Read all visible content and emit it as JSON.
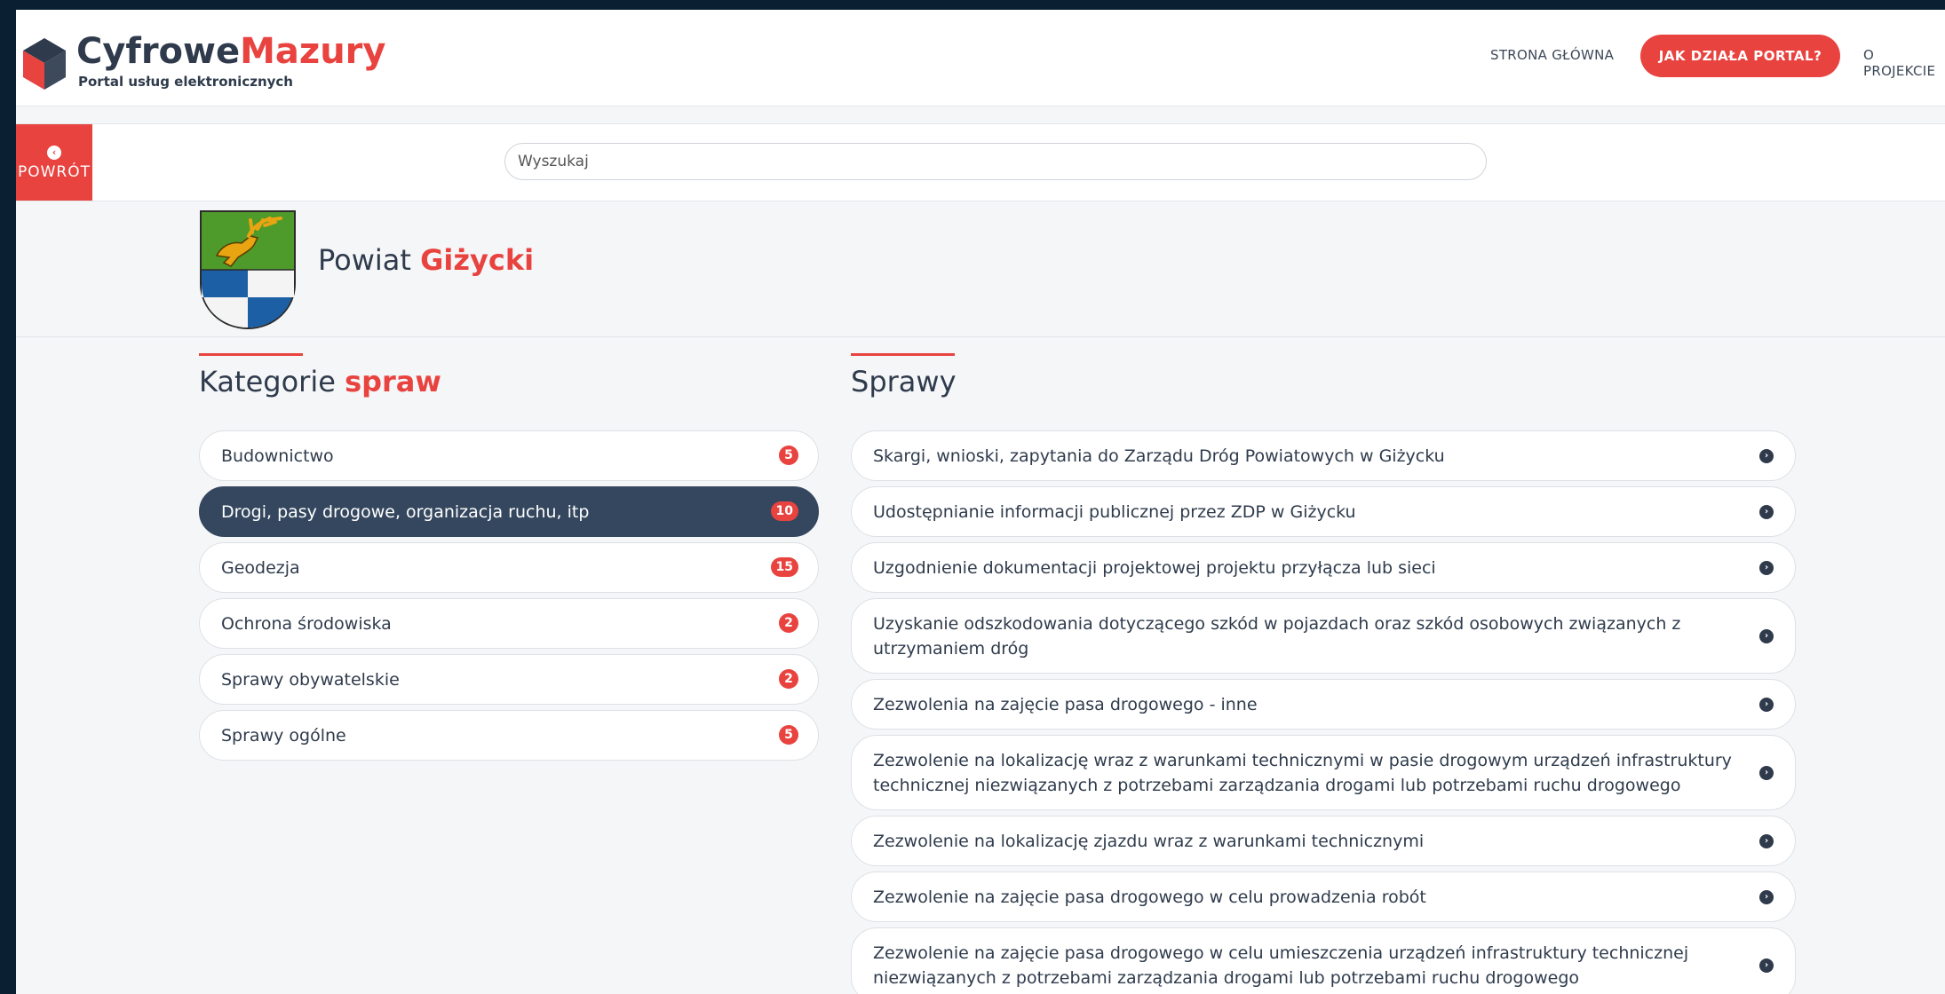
{
  "brand": {
    "name_part1": "Cyfrowe",
    "name_part2": "Mazury",
    "tagline": "Portal usług elektronicznych",
    "accent_color": "#e8433f",
    "dark_color": "#34475e"
  },
  "nav": {
    "home": "STRONA GŁÓWNA",
    "how_it_works": "JAK DZIAŁA PORTAL?",
    "about": "O PROJEKCIE"
  },
  "back": {
    "label": "POWRÓT",
    "icon": "chevron-left-circle-icon"
  },
  "search": {
    "placeholder": "Wyszukaj",
    "value": ""
  },
  "header": {
    "title_prefix": "Powiat ",
    "title_highlight": "Giżycki",
    "crest_icon": "coat-of-arms-deer"
  },
  "categories": {
    "title_prefix": "Kategorie ",
    "title_highlight": "spraw",
    "items": [
      {
        "label": "Budownictwo",
        "count": "5",
        "active": false
      },
      {
        "label": "Drogi, pasy drogowe, organizacja ruchu, itp",
        "count": "10",
        "active": true
      },
      {
        "label": "Geodezja",
        "count": "15",
        "active": false
      },
      {
        "label": "Ochrona środowiska",
        "count": "2",
        "active": false
      },
      {
        "label": "Sprawy obywatelskie",
        "count": "2",
        "active": false
      },
      {
        "label": "Sprawy ogólne",
        "count": "5",
        "active": false
      }
    ]
  },
  "cases": {
    "title": "Sprawy",
    "items": [
      {
        "label": "Skargi, wnioski, zapytania do Zarządu Dróg Powiatowych w Giżycku"
      },
      {
        "label": "Udostępnianie informacji publicznej przez ZDP w Giżycku"
      },
      {
        "label": "Uzgodnienie dokumentacji projektowej projektu przyłącza lub sieci"
      },
      {
        "label": "Uzyskanie odszkodowania dotyczącego szkód w pojazdach oraz szkód osobowych związanych z utrzymaniem dróg"
      },
      {
        "label": "Zezwolenia na zajęcie pasa drogowego - inne"
      },
      {
        "label": "Zezwolenie na lokalizację wraz z warunkami technicznymi w pasie drogowym urządzeń infrastruktury technicznej niezwiązanych z potrzebami zarządzania drogami lub potrzebami ruchu drogowego"
      },
      {
        "label": "Zezwolenie na lokalizację zjazdu wraz z warunkami technicznymi"
      },
      {
        "label": "Zezwolenie na zajęcie pasa drogowego w celu prowadzenia robót"
      },
      {
        "label": "Zezwolenie na zajęcie pasa drogowego w celu umieszczenia urządzeń infrastruktury technicznej niezwiązanych z potrzebami zarządzania drogami lub potrzebami ruchu drogowego"
      }
    ]
  }
}
